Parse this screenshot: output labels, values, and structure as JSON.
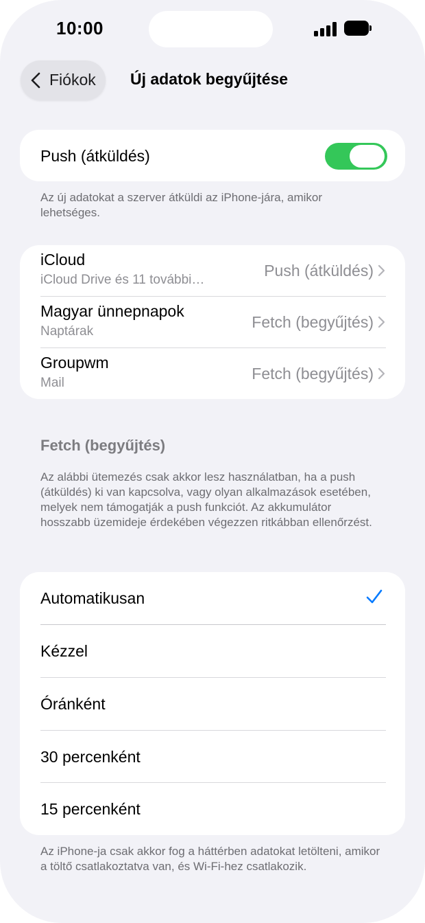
{
  "status_bar": {
    "time": "10:00"
  },
  "nav": {
    "back_label": "Fiókok",
    "title": "Új adatok begyűjtése"
  },
  "push": {
    "label": "Push (átküldés)",
    "enabled": true,
    "footnote": "Az új adatokat a szerver átküldi az iPhone-jára, amikor lehetséges."
  },
  "accounts": [
    {
      "title": "iCloud",
      "subtitle": "iCloud Drive és 11 további…",
      "value": "Push (átküldés)"
    },
    {
      "title": "Magyar ünnepnapok",
      "subtitle": "Naptárak",
      "value": "Fetch (begyűjtés)"
    },
    {
      "title": "Groupwm",
      "subtitle": "Mail",
      "value": "Fetch (begyűjtés)"
    }
  ],
  "fetch": {
    "header": "Fetch (begyűjtés)",
    "description": "Az alábbi ütemezés csak akkor lesz használatban, ha a push (átküldés) ki van kapcsolva, vagy olyan alkalmazások esetében, melyek nem támogatják a push funkciót. Az akkumulátor hosszabb üzemideje érdekében végezzen ritkábban ellenőrzést.",
    "options": [
      "Automatikusan",
      "Kézzel",
      "Óránként",
      "30 percenként",
      "15 percenként"
    ],
    "selected": "Automatikusan",
    "footnote": "Az iPhone-ja csak akkor fog a háttérben adatokat letölteni, amikor a töltő csatlakoztatva van, és Wi-Fi-hez csatlakozik."
  },
  "colors": {
    "toggle_on": "#34c759",
    "accent": "#007aff",
    "background": "#f2f2f7"
  }
}
